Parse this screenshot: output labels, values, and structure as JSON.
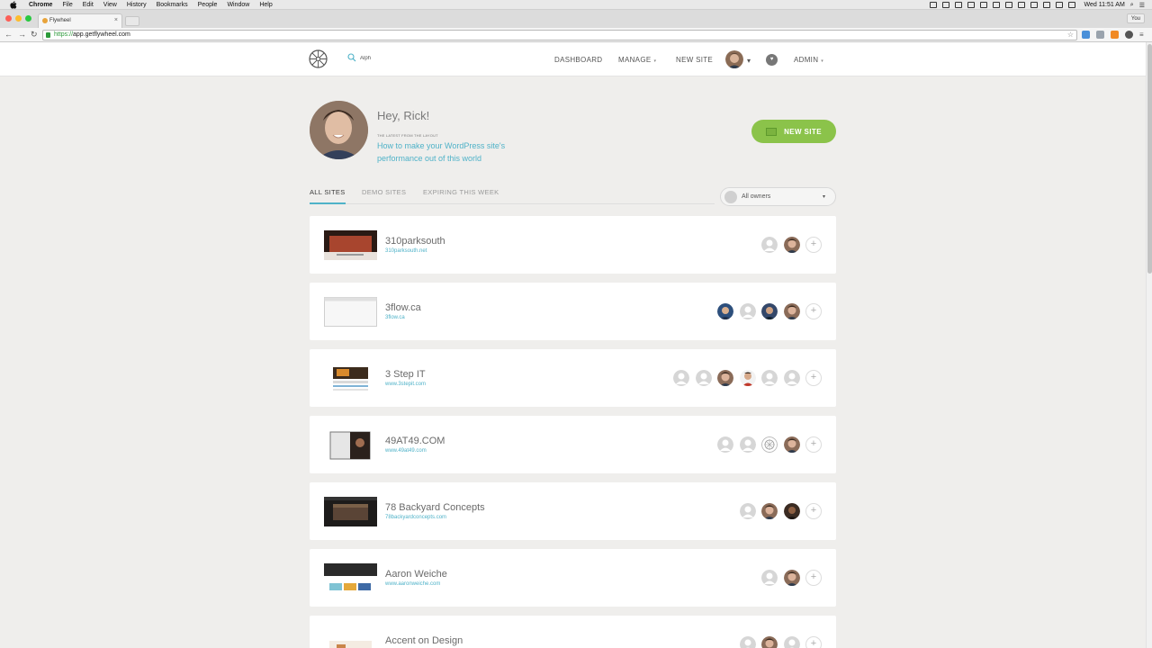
{
  "menubar": {
    "app": "Chrome",
    "items": [
      "File",
      "Edit",
      "View",
      "History",
      "Bookmarks",
      "People",
      "Window",
      "Help"
    ],
    "clock": "Wed 11:51 AM"
  },
  "browser": {
    "tab_title": "Flywheel",
    "tab_close": "×",
    "profile": "You",
    "url_protocol": "https://",
    "url_host": "app.getflywheel.com",
    "back": "←",
    "forward": "→",
    "reload": "↻",
    "star": "☆"
  },
  "header": {
    "search_value": "Alph",
    "nav": {
      "dashboard": "DASHBOARD",
      "manage": "MANAGE",
      "new_site": "NEW SITE",
      "admin": "ADMIN"
    },
    "caret": "▾",
    "heart": "♥"
  },
  "greeting": {
    "hello": "Hey, Rick!",
    "latest_label": "THE LATEST FROM THE LAYOUT",
    "latest_link": "How to make your WordPress site's performance out of this world",
    "new_site_button": "NEW SITE"
  },
  "tabs": {
    "all": "ALL SITES",
    "demo": "DEMO SITES",
    "expiring": "EXPIRING THIS WEEK"
  },
  "owners_filter": {
    "label": "All owners",
    "caret": "▾"
  },
  "sites": [
    {
      "name": "310parksouth",
      "url": "310parksouth.net",
      "thumb": "dark-red",
      "avatars": [
        "ghost",
        "photo"
      ]
    },
    {
      "name": "3flow.ca",
      "url": "3flow.ca",
      "thumb": "blank",
      "avatars": [
        "blue",
        "ghost",
        "dark-blue",
        "photo"
      ]
    },
    {
      "name": "3 Step IT",
      "url": "www.3stepit.com",
      "thumb": "orange-dark",
      "avatars": [
        "ghost",
        "ghost",
        "photo",
        "red-shirt",
        "ghost",
        "ghost"
      ]
    },
    {
      "name": "49AT49.COM",
      "url": "www.49at49.com",
      "thumb": "book",
      "avatars": [
        "ghost",
        "ghost",
        "pattern",
        "photo"
      ]
    },
    {
      "name": "78 Backyard Concepts",
      "url": "78backyardconcepts.com",
      "thumb": "dark-brown",
      "avatars": [
        "ghost",
        "photo",
        "dark"
      ]
    },
    {
      "name": "Aaron Weiche",
      "url": "www.aaronweiche.com",
      "thumb": "dark-yellow",
      "avatars": [
        "ghost",
        "photo"
      ]
    },
    {
      "name": "Accent on Design",
      "url": "",
      "thumb": "light",
      "avatars": [
        "ghost",
        "photo",
        "ghost"
      ]
    }
  ],
  "add_member": "+"
}
